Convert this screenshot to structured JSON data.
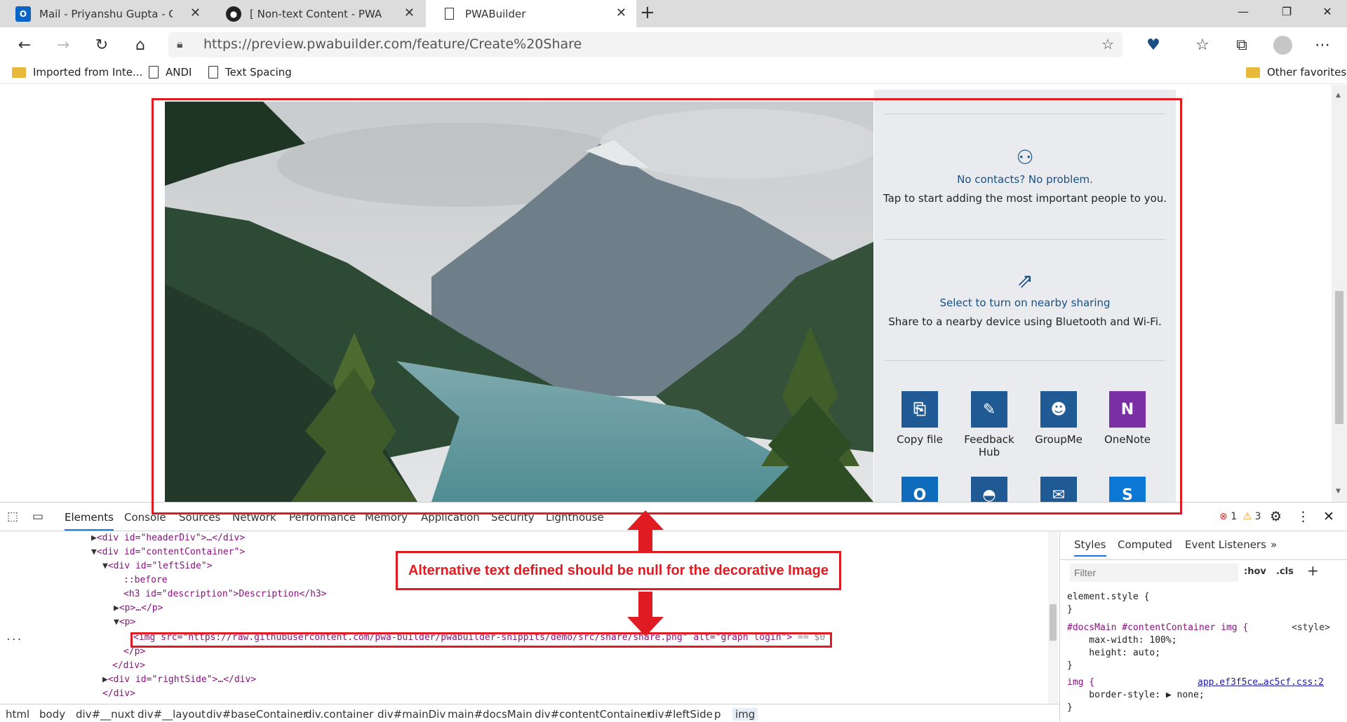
{
  "tabs": [
    {
      "title": "Mail - Priyanshu Gupta - Outlook",
      "icon": "outlook-icon",
      "icon_text": "O"
    },
    {
      "title": "[ Non-text Content - PWA Builder",
      "icon": "github-icon",
      "icon_text": "●"
    },
    {
      "title": "PWABuilder",
      "icon": "page-icon",
      "icon_text": ""
    }
  ],
  "new_tab_glyph": "+",
  "window_controls": {
    "minimize": "—",
    "maximize": "❐",
    "close": "✕"
  },
  "address": {
    "url": "https://preview.pwabuilder.com/feature/Create%20Share"
  },
  "favorites": [
    {
      "label": "Imported from Inte...",
      "icon": "folder-icon"
    },
    {
      "label": "ANDI",
      "icon": "page-icon"
    },
    {
      "label": "Text Spacing",
      "icon": "page-icon"
    }
  ],
  "other_favorites": "Other favorites",
  "share_panel": {
    "contacts_title": "No contacts? No problem.",
    "contacts_desc": "Tap to start adding the most important people to you.",
    "nearby_title": "Select to turn on nearby sharing",
    "nearby_desc": "Share to a nearby device using Bluetooth and Wi-Fi.",
    "apps": [
      {
        "label": "Copy file",
        "color": "#1f5a94"
      },
      {
        "label": "Feedback Hub",
        "color": "#1f5a94"
      },
      {
        "label": "GroupMe",
        "color": "#1f5a94"
      },
      {
        "label": "OneNote",
        "color": "#7b2fa5"
      }
    ],
    "apps_row2_colors": [
      "#0f6cbd",
      "#1f5a94",
      "#1f5a94",
      "#0a78d4"
    ]
  },
  "annotation": {
    "callout": "Alternative text defined should be null for the decorative Image"
  },
  "devtools": {
    "tabs": [
      "Elements",
      "Console",
      "Sources",
      "Network",
      "Performance",
      "Memory",
      "Application",
      "Security",
      "Lighthouse"
    ],
    "errors": "1",
    "warnings": "3",
    "dom_lines": [
      {
        "indent": 0,
        "arrow": "▶",
        "html": "<div id=\"headerDiv\">…</div>"
      },
      {
        "indent": 0,
        "arrow": "▼",
        "html": "<div id=\"contentContainer\">"
      },
      {
        "indent": 1,
        "arrow": "▼",
        "html": "<div id=\"leftSide\">"
      },
      {
        "indent": 2,
        "arrow": "",
        "html": "::before"
      },
      {
        "indent": 2,
        "arrow": "",
        "html": "<h3 id=\"description\">Description</h3>"
      },
      {
        "indent": 2,
        "arrow": "▶",
        "html": "<p>…</p>"
      },
      {
        "indent": 2,
        "arrow": "▼",
        "html": "<p>"
      },
      {
        "indent": 3,
        "arrow": "",
        "html": "<img src=\"https://raw.githubusercontent.com/pwa-builder/pwabuilder-snippits/demo/src/share/share.png\" alt=\"graph login\">"
      },
      {
        "indent": 2,
        "arrow": "",
        "html": "</p>"
      },
      {
        "indent": 1,
        "arrow": "",
        "html": "</div>"
      },
      {
        "indent": 1,
        "arrow": "▶",
        "html": "<div id=\"rightSide\">…</div>"
      },
      {
        "indent": 0,
        "arrow": "",
        "html": "</div>"
      }
    ],
    "selected_suffix": "== $0",
    "ellipsis": "...",
    "styles_tabs": [
      "Styles",
      "Computed",
      "Event Listeners"
    ],
    "filter_placeholder": "Filter",
    "hov": ":hov",
    "cls": ".cls",
    "rules": [
      "element.style {",
      "}",
      "#docsMain #contentContainer img {",
      "    max-width: 100%;",
      "    height: auto;",
      "}",
      "img {",
      "    border-style: ▶ none;",
      "}"
    ],
    "rule_source_1": "<style>",
    "rule_source_2": "app.ef3f5ce…ac5cf.css:2",
    "breadcrumbs": [
      "html",
      "body",
      "div#__nuxt",
      "div#__layout",
      "div#baseContainer",
      "div.container",
      "div#mainDiv",
      "main#docsMain",
      "div#contentContainer",
      "div#leftSide",
      "p",
      "img"
    ]
  }
}
